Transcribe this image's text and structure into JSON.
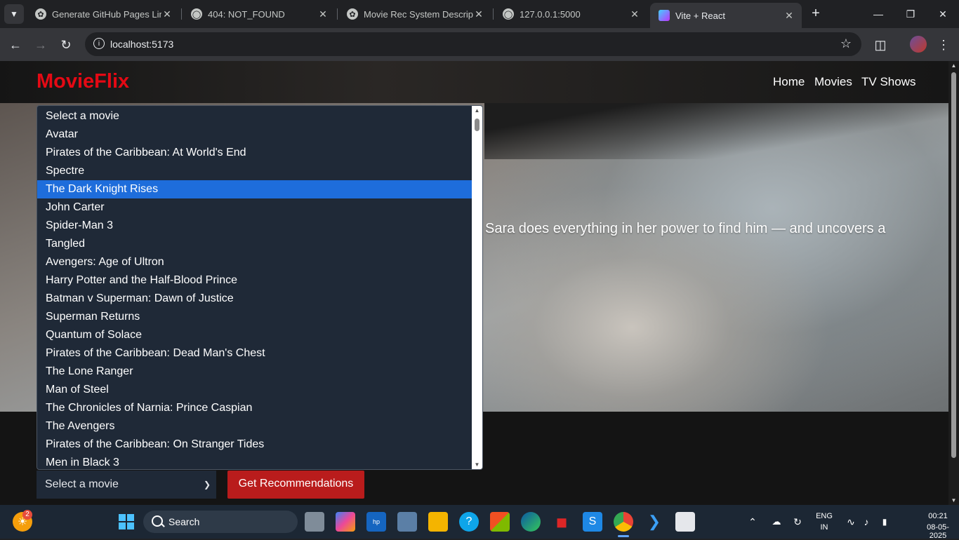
{
  "browser": {
    "tabs": [
      {
        "title": "Generate GitHub Pages Link",
        "icon": "openai-icon",
        "active": false
      },
      {
        "title": "404: NOT_FOUND",
        "icon": "globe-icon",
        "active": false
      },
      {
        "title": "Movie Rec System Descriptio",
        "icon": "openai-icon",
        "active": false
      },
      {
        "title": "127.0.0.1:5000",
        "icon": "globe-icon",
        "active": false
      },
      {
        "title": "Vite + React",
        "icon": "vite-icon",
        "active": true
      }
    ],
    "url": "localhost:5173"
  },
  "page": {
    "logo": "MovieFlix",
    "nav": [
      "Home",
      "Movies",
      "TV Shows"
    ],
    "hero_description": "Sara does everything in her power to find him — and uncovers a",
    "select_value": "Select a movie",
    "button_label": "Get Recommendations",
    "dropdown_options": [
      "Select a movie",
      "Avatar",
      "Pirates of the Caribbean: At World's End",
      "Spectre",
      "The Dark Knight Rises",
      "John Carter",
      "Spider-Man 3",
      "Tangled",
      "Avengers: Age of Ultron",
      "Harry Potter and the Half-Blood Prince",
      "Batman v Superman: Dawn of Justice",
      "Superman Returns",
      "Quantum of Solace",
      "Pirates of the Caribbean: Dead Man's Chest",
      "The Lone Ranger",
      "Man of Steel",
      "The Chronicles of Narnia: Prince Caspian",
      "The Avengers",
      "Pirates of the Caribbean: On Stranger Tides",
      "Men in Black 3"
    ],
    "highlighted_option": "The Dark Knight Rises"
  },
  "taskbar": {
    "search_label": "Search",
    "notification_count": "2",
    "language": "ENG",
    "region": "IN",
    "time": "00:21",
    "date": "08-05-2025"
  },
  "colors": {
    "brand_red": "#e50914",
    "button_red": "#b91c1c",
    "dropdown_bg": "#1f2937",
    "highlight": "#1e6ddb"
  }
}
